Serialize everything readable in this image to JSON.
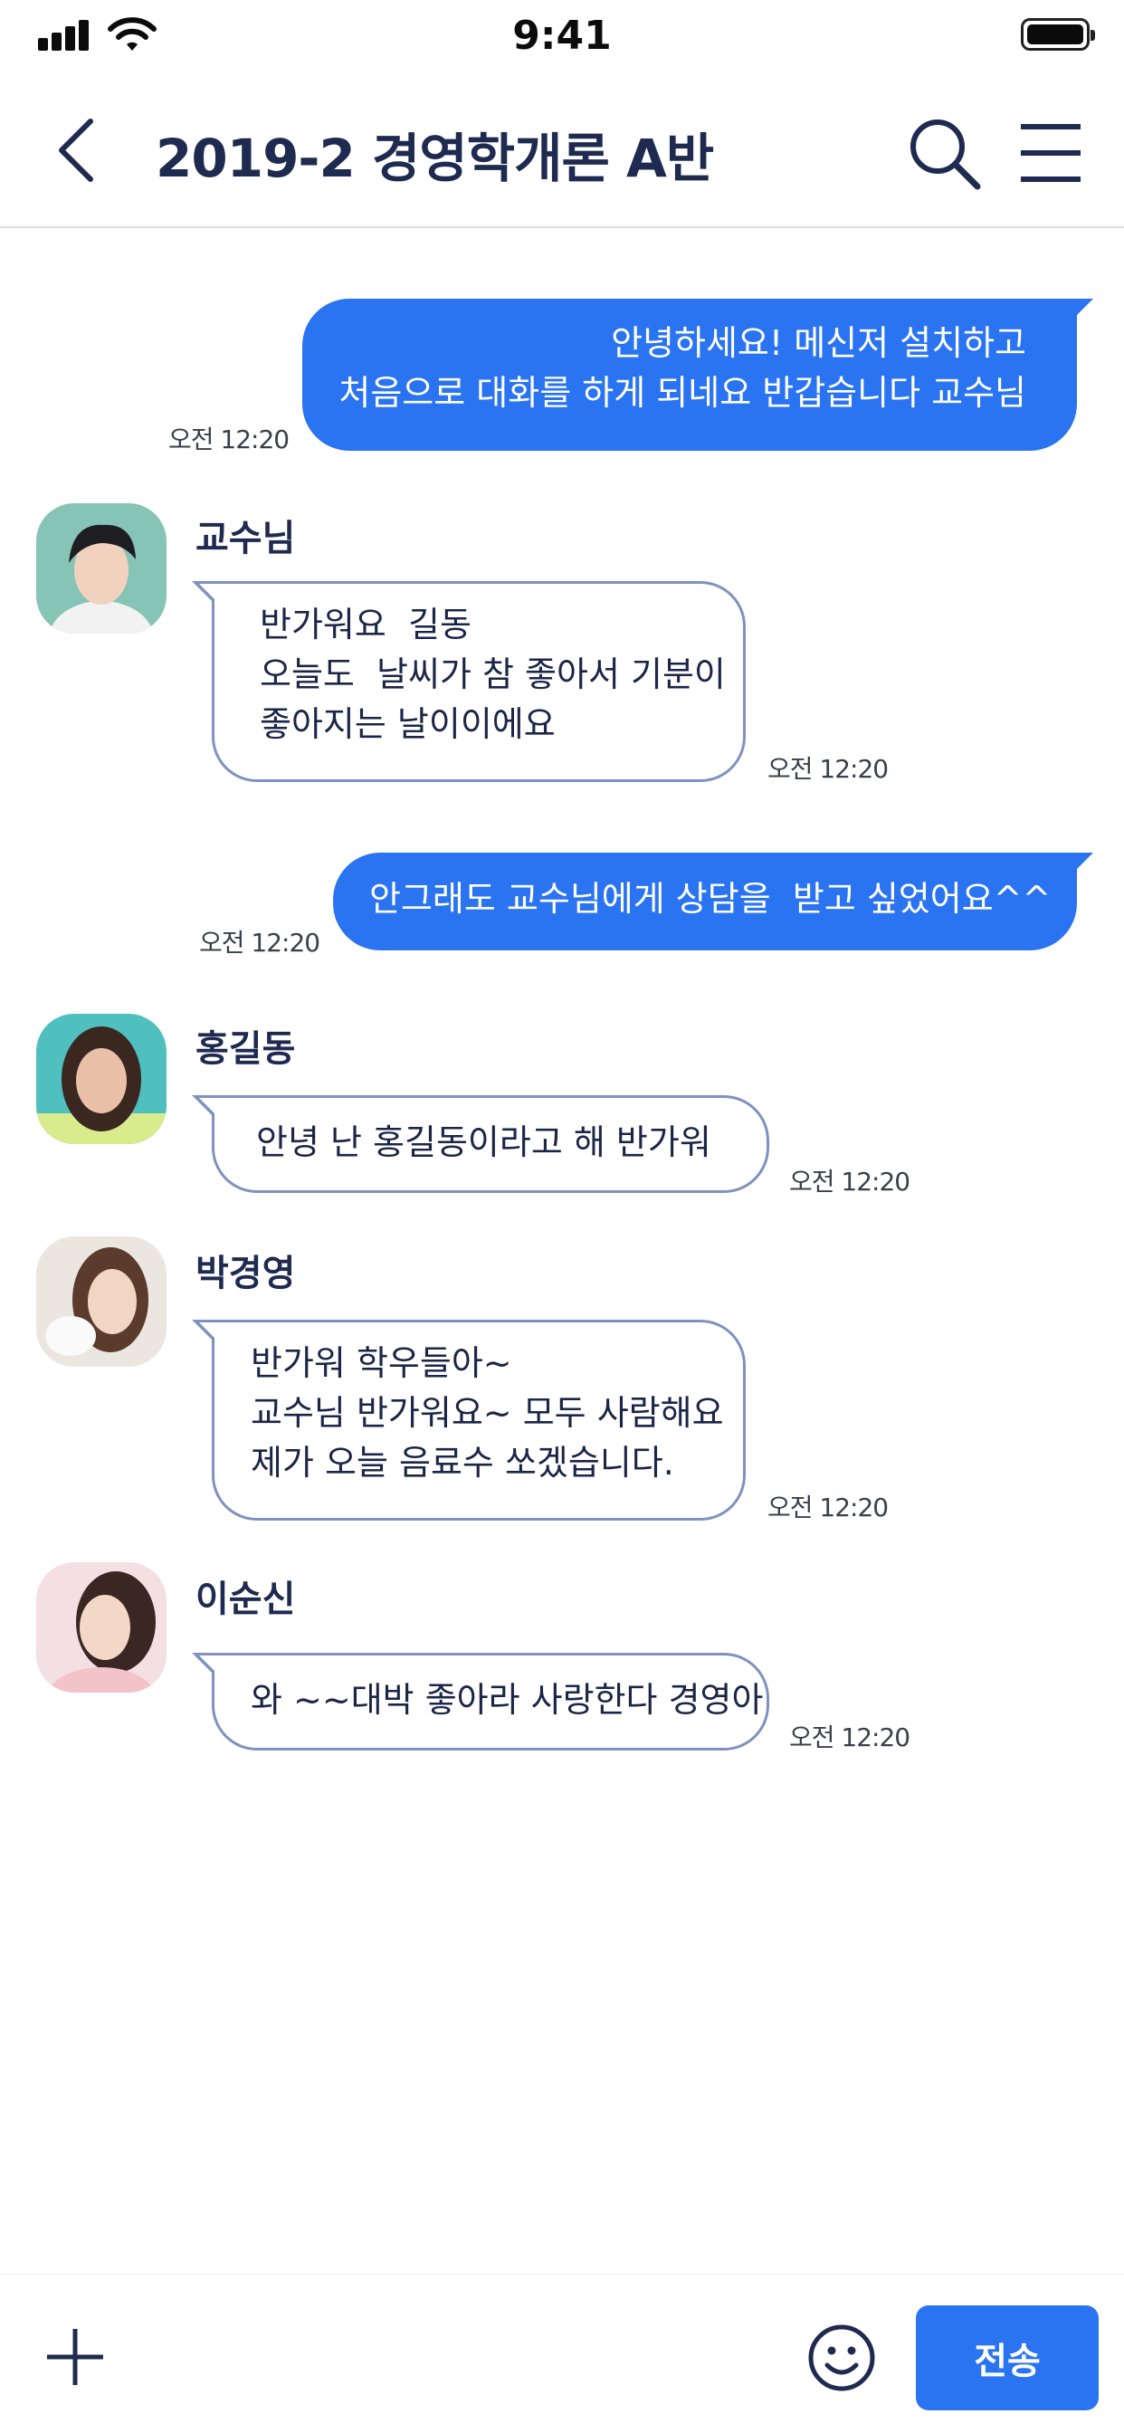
{
  "status_bar": {
    "time": "9:41"
  },
  "header": {
    "title": "2019-2 경영학개론 A반",
    "back_icon": "chevron-left-icon",
    "search_icon": "search-icon",
    "menu_icon": "hamburger-menu-icon"
  },
  "messages": [
    {
      "direction": "out",
      "lines": [
        "안녕하세요! 메신저 설치하고",
        "처음으로 대화를 하게 되네요 반갑습니다 교수님"
      ],
      "time": "오전 12:20"
    },
    {
      "direction": "in",
      "sender": "교수님",
      "lines": [
        "반가워요  길동",
        "오늘도  날씨가 참 좋아서 기분이",
        "좋아지는 날이이에요"
      ],
      "time": "오전 12:20"
    },
    {
      "direction": "out",
      "lines": [
        "안그래도 교수님에게 상담을  받고 싶었어요^^"
      ],
      "time": "오전 12:20"
    },
    {
      "direction": "in",
      "sender": "홍길동",
      "lines": [
        "안녕 난 홍길동이라고 해 반가워"
      ],
      "time": "오전 12:20"
    },
    {
      "direction": "in",
      "sender": "박경영",
      "lines": [
        "반가워 학우들아~",
        "교수님 반가워요~ 모두 사람해요",
        "제가 오늘 음료수 쏘겠습니다."
      ],
      "time": "오전 12:20"
    },
    {
      "direction": "in",
      "sender": "이순신",
      "lines": [
        "와 ~~대박 좋아라 사랑한다 경영아"
      ],
      "time": "오전 12:20"
    }
  ],
  "bottom_bar": {
    "send_label": "전송",
    "plus_icon": "plus-icon",
    "emoji_icon": "smiley-icon"
  },
  "colors": {
    "accent": "#2a74f2",
    "title": "#1e2a50",
    "bubble_border": "#7f92bf"
  }
}
